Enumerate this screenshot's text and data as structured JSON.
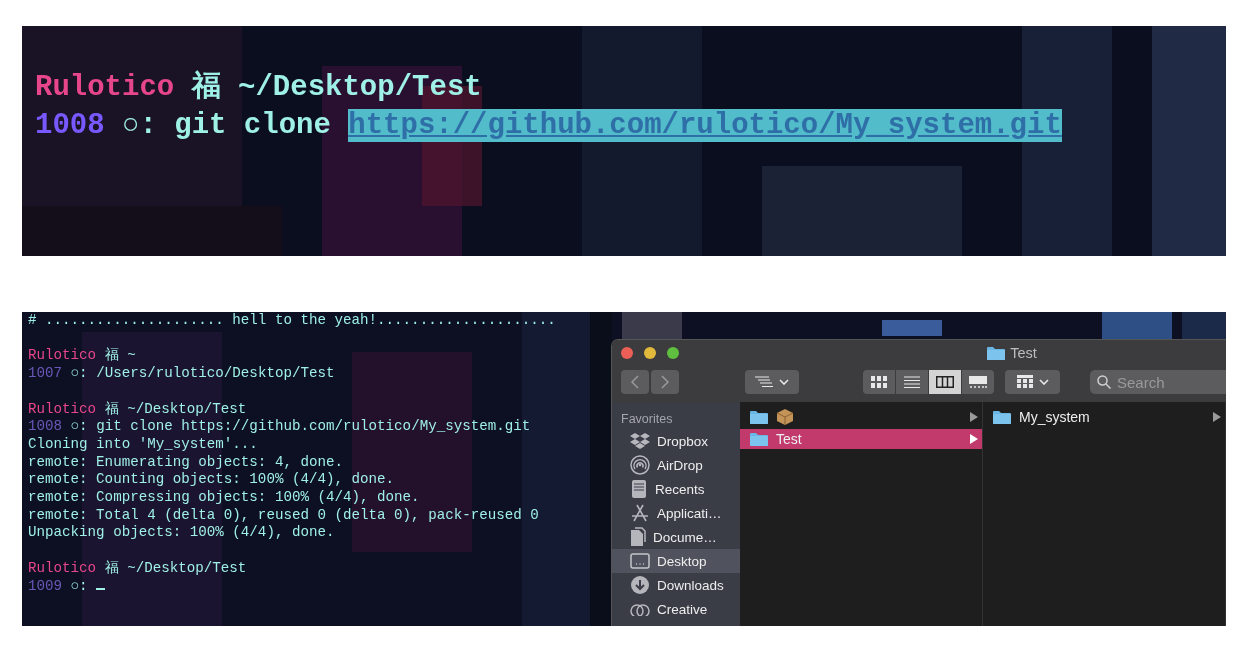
{
  "top_terminal": {
    "lines": [
      {
        "kind": "prompt",
        "user": "Rulotico",
        "glyph": "福",
        "path": "~/Desktop/Test"
      },
      {
        "kind": "command",
        "number": "1008",
        "symbol": "○:",
        "text": "git clone",
        "argument": "https://github.com/rulotico/My_system.git",
        "highlighted": true
      }
    ]
  },
  "bottom_terminal": {
    "lines": [
      {
        "kind": "output",
        "text": "# ..................... hell to the yeah!....................."
      },
      {
        "kind": "blank"
      },
      {
        "kind": "prompt",
        "user": "Rulotico",
        "glyph": "福",
        "path": "~"
      },
      {
        "kind": "command",
        "number": "1007",
        "symbol": "○:",
        "text": "/Users/rulotico/Desktop/Test"
      },
      {
        "kind": "blank"
      },
      {
        "kind": "prompt",
        "user": "Rulotico",
        "glyph": "福",
        "path": "~/Desktop/Test"
      },
      {
        "kind": "command",
        "number": "1008",
        "symbol": "○:",
        "text": "git clone https://github.com/rulotico/My_system.git"
      },
      {
        "kind": "output",
        "text": "Cloning into 'My_system'..."
      },
      {
        "kind": "output",
        "text": "remote: Enumerating objects: 4, done."
      },
      {
        "kind": "output",
        "text": "remote: Counting objects: 100% (4/4), done."
      },
      {
        "kind": "output",
        "text": "remote: Compressing objects: 100% (4/4), done."
      },
      {
        "kind": "output",
        "text": "remote: Total 4 (delta 0), reused 0 (delta 0), pack-reused 0"
      },
      {
        "kind": "output",
        "text": "Unpacking objects: 100% (4/4), done."
      },
      {
        "kind": "blank"
      },
      {
        "kind": "prompt",
        "user": "Rulotico",
        "glyph": "福",
        "path": "~/Desktop/Test"
      },
      {
        "kind": "command",
        "number": "1009",
        "symbol": "○:",
        "cursor": true
      }
    ]
  },
  "finder": {
    "title": "Test",
    "views": [
      {
        "kind": "icons",
        "selected": false
      },
      {
        "kind": "list",
        "selected": false
      },
      {
        "kind": "columns",
        "selected": true
      },
      {
        "kind": "gallery",
        "selected": false
      }
    ],
    "search": {
      "placeholder": "Search"
    },
    "sidebar": {
      "heading": "Favorites",
      "items": [
        {
          "kind": "dropbox",
          "label": "Dropbox",
          "selected": false
        },
        {
          "kind": "airdrop",
          "label": "AirDrop",
          "selected": false
        },
        {
          "kind": "recents",
          "label": "Recents",
          "selected": false
        },
        {
          "kind": "applications",
          "label": "Applicati…",
          "selected": false
        },
        {
          "kind": "documents",
          "label": "Docume…",
          "selected": false
        },
        {
          "kind": "desktop",
          "label": "Desktop",
          "selected": true
        },
        {
          "kind": "downloads",
          "label": "Downloads",
          "selected": false
        },
        {
          "kind": "creative",
          "label": "Creative",
          "selected": false
        }
      ]
    },
    "columns": [
      {
        "items": [
          {
            "kind": "package",
            "selected": false
          },
          {
            "kind": "folder",
            "label": "Test",
            "selected": true
          }
        ]
      },
      {
        "items": [
          {
            "kind": "folder",
            "label": "My_system",
            "selected": false
          }
        ]
      }
    ]
  }
}
